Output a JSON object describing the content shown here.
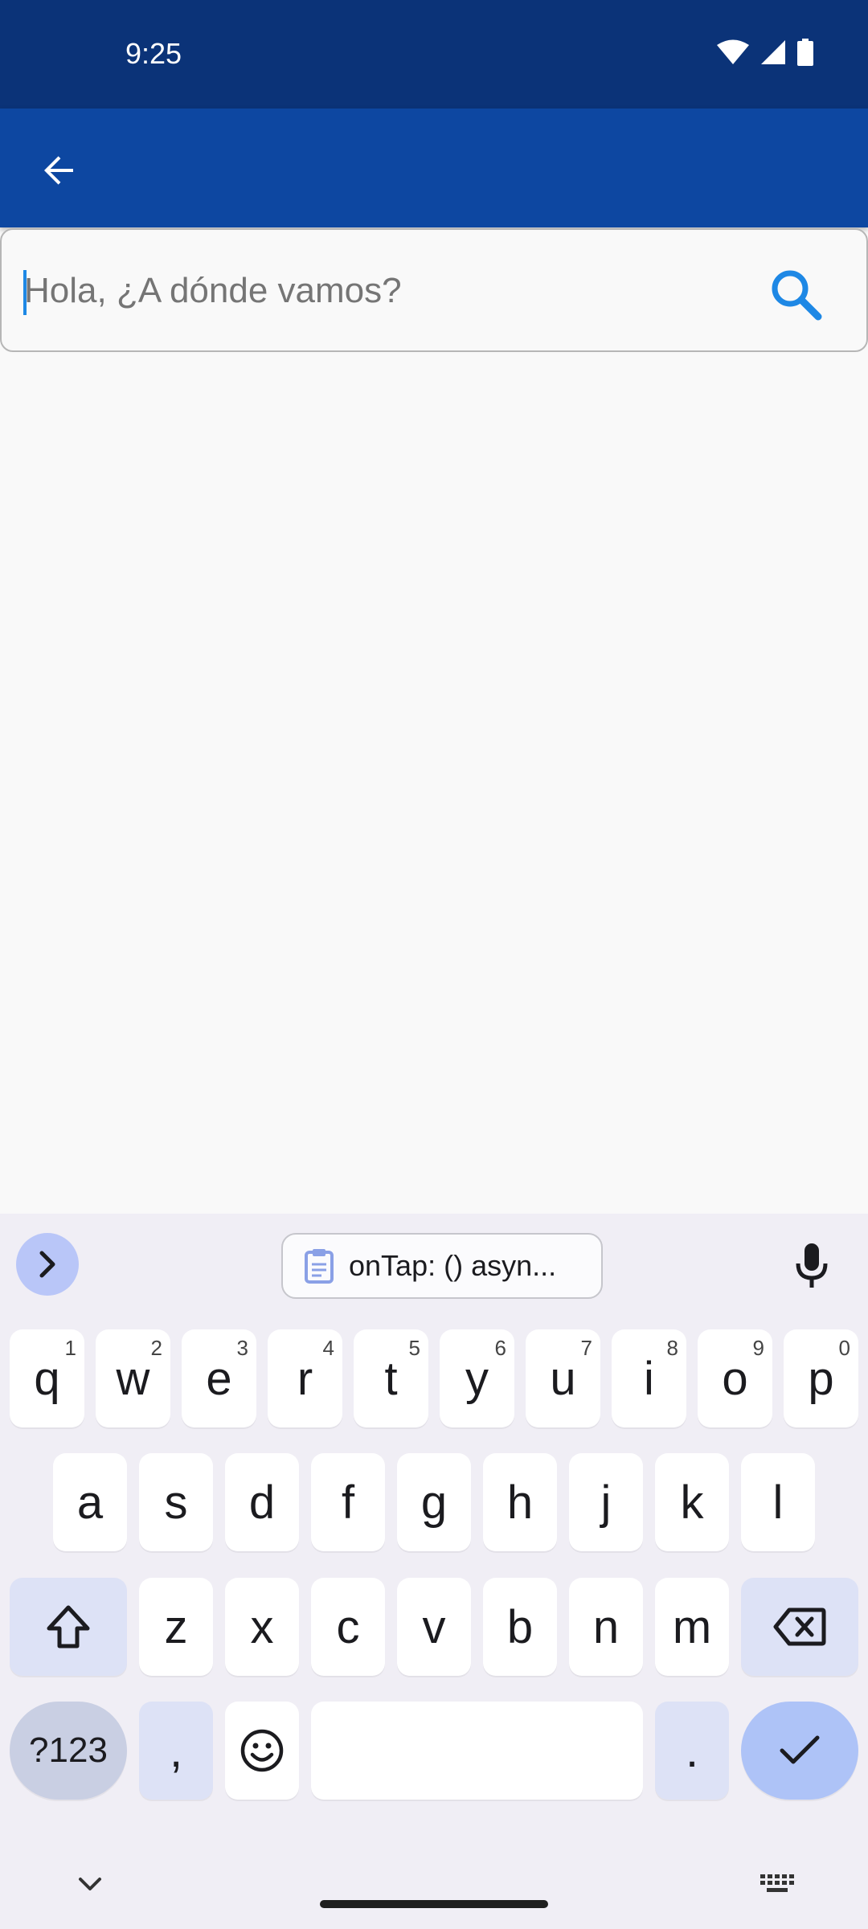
{
  "status_bar": {
    "time": "9:25",
    "icons": [
      "wifi-icon",
      "signal-icon",
      "battery-icon"
    ]
  },
  "app_bar": {
    "back_icon": "arrow-back-icon"
  },
  "search": {
    "placeholder": "Hola, ¿A dónde vamos?",
    "value": "",
    "icon": "search-icon"
  },
  "keyboard": {
    "clipboard_suggestion": "onTap: () asyn...",
    "row1": [
      {
        "k": "q",
        "h": "1"
      },
      {
        "k": "w",
        "h": "2"
      },
      {
        "k": "e",
        "h": "3"
      },
      {
        "k": "r",
        "h": "4"
      },
      {
        "k": "t",
        "h": "5"
      },
      {
        "k": "y",
        "h": "6"
      },
      {
        "k": "u",
        "h": "7"
      },
      {
        "k": "i",
        "h": "8"
      },
      {
        "k": "o",
        "h": "9"
      },
      {
        "k": "p",
        "h": "0"
      }
    ],
    "row2": [
      "a",
      "s",
      "d",
      "f",
      "g",
      "h",
      "j",
      "k",
      "l"
    ],
    "row3": [
      "z",
      "x",
      "c",
      "v",
      "b",
      "n",
      "m"
    ],
    "symbols_label": "?123",
    "comma": ",",
    "period": "."
  },
  "colors": {
    "status_bar": "#0b3378",
    "app_bar": "#0d47a1",
    "accent": "#1e88e5",
    "keyboard_bg": "#f0eef5"
  }
}
